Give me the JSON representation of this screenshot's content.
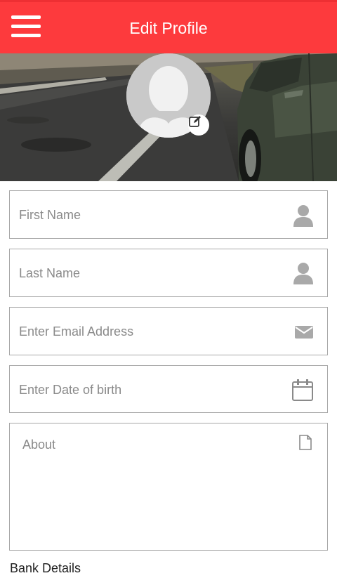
{
  "header": {
    "title": "Edit Profile",
    "menu_icon": "hamburger-menu-icon",
    "background": "#fd3a3d"
  },
  "profile": {
    "avatar_icon": "user-silhouette-icon",
    "edit_icon": "edit-pencil-icon"
  },
  "form": {
    "first_name": {
      "placeholder": "First Name",
      "icon": "person-icon"
    },
    "last_name": {
      "placeholder": "Last Name",
      "icon": "person-icon"
    },
    "email": {
      "placeholder": "Enter Email Address",
      "icon": "envelope-icon"
    },
    "dob": {
      "placeholder": "Enter Date of birth",
      "icon": "calendar-icon"
    },
    "about": {
      "placeholder": "About",
      "icon": "document-icon"
    }
  },
  "sections": {
    "bank_details": "Bank Details"
  }
}
